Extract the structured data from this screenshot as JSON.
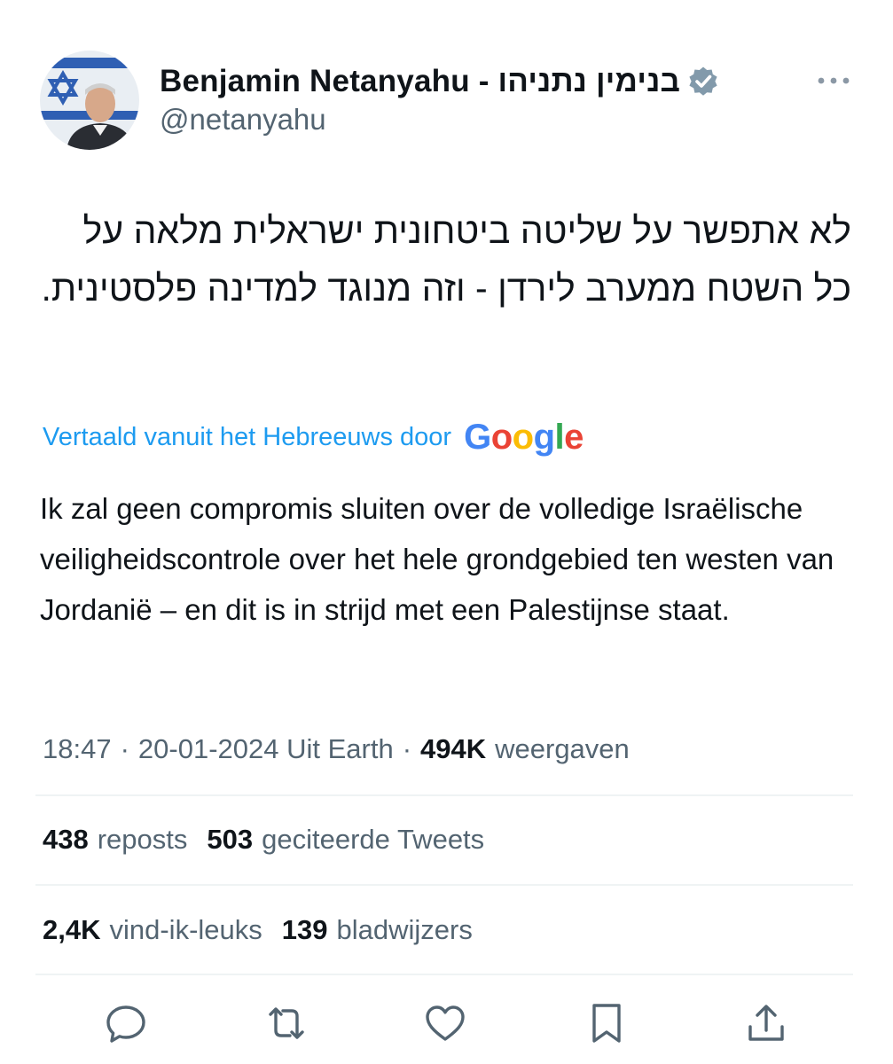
{
  "author": {
    "name": "Benjamin Netanyahu - בנימין נתניהו",
    "handle": "@netanyahu",
    "verified_icon": "verified-badge-icon"
  },
  "tweet": {
    "hebrew_text": "לא אתפשר על שליטה ביטחונית ישראלית מלאה על כל השטח ממערב לירדן - וזה מנוגד למדינה פלסטינית.",
    "translation_label": "Vertaald vanuit het Hebreeuws door",
    "translation_provider_letters": [
      "G",
      "o",
      "o",
      "g",
      "l",
      "e"
    ],
    "translated_text": "Ik zal geen compromis sluiten over de volledige Israëlische veiligheidscontrole over het hele grondgebied ten westen van Jordanië – en dit is in strijd met een Palestijnse staat."
  },
  "meta": {
    "time": "18:47",
    "separator": "·",
    "date_source": "20-01-2024 Uit Earth",
    "views_count": "494K",
    "views_label": "weergaven"
  },
  "stats": {
    "reposts_count": "438",
    "reposts_label": "reposts",
    "quotes_count": "503",
    "quotes_label": "geciteerde Tweets",
    "likes_count": "2,4K",
    "likes_label": "vind-ik-leuks",
    "bookmarks_count": "139",
    "bookmarks_label": "bladwijzers"
  },
  "actions": [
    "reply-icon",
    "retweet-icon",
    "like-icon",
    "bookmark-icon",
    "share-icon"
  ],
  "colors": {
    "link_blue": "#1d9bf0",
    "secondary_text": "#536471",
    "primary_text": "#0f1419",
    "verified_gray": "#829aab",
    "divider": "#eff3f4",
    "google_blue": "#4285f4",
    "google_red": "#ea4335",
    "google_yellow": "#fbbc05",
    "google_green": "#34a853"
  }
}
